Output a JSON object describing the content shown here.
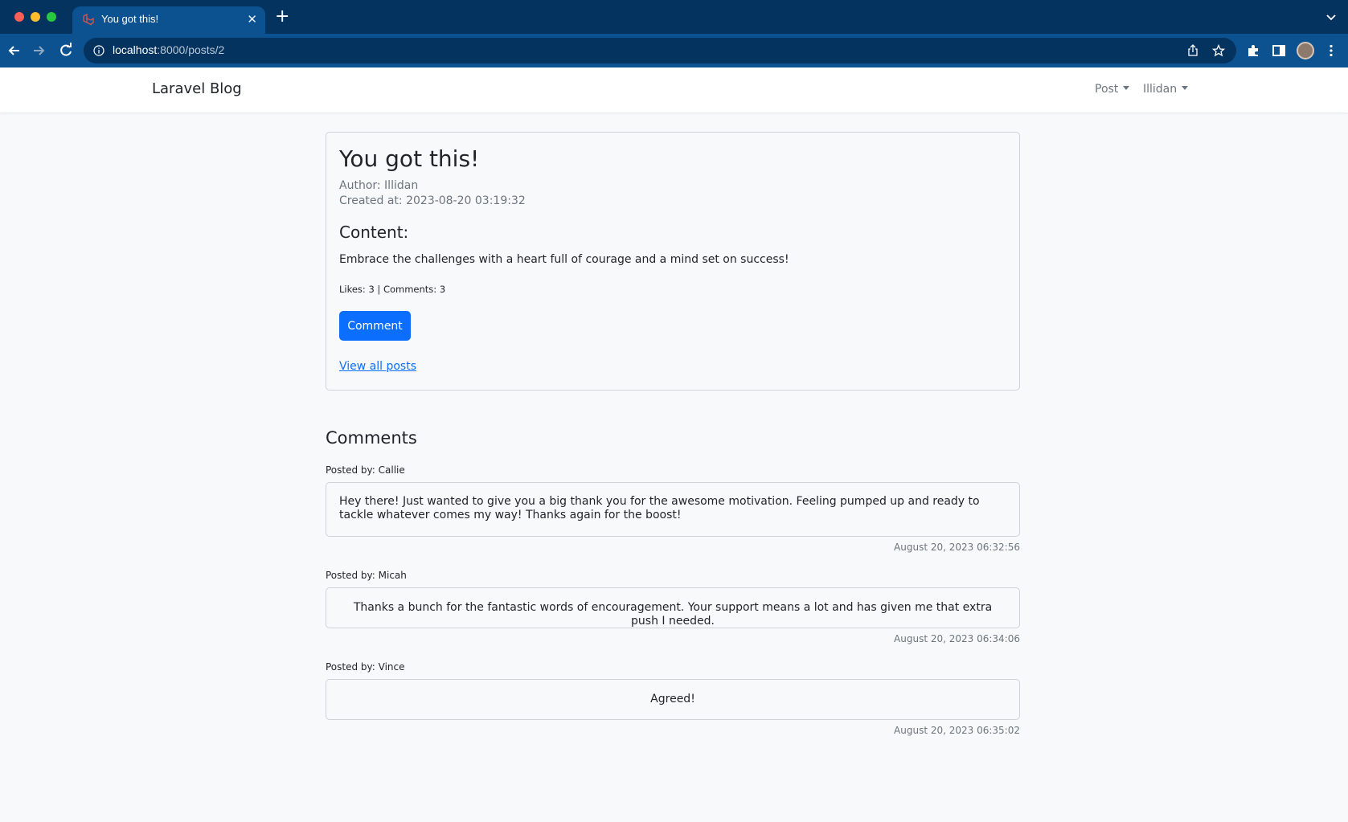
{
  "browser": {
    "tab_title": "You got this!",
    "tab_close": "✕",
    "new_tab": "+",
    "url_host": "localhost",
    "url_path": ":8000/posts/2"
  },
  "navbar": {
    "brand": "Laravel Blog",
    "menus": [
      {
        "label": "Post"
      },
      {
        "label": "Illidan"
      }
    ]
  },
  "post": {
    "title": "You got this!",
    "author": "Author: Illidan",
    "created_at": "Created at: 2023-08-20 03:19:32",
    "content_heading": "Content:",
    "content": "Embrace the challenges with a heart full of courage and a mind set on success!",
    "stats": "Likes: 3 | Comments: 3",
    "comment_button": "Comment",
    "view_all_link": "View all posts"
  },
  "comments": {
    "heading": "Comments",
    "items": [
      {
        "posted_by": "Posted by: Callie",
        "text": "Hey there! Just wanted to give you a big thank you for the awesome motivation. Feeling pumped up and ready to tackle whatever comes my way! Thanks again for the boost!",
        "date": "August 20, 2023 06:32:56"
      },
      {
        "posted_by": "Posted by: Micah",
        "text": "Thanks a bunch for the fantastic words of encouragement. Your support means a lot and has given me that extra push I needed.",
        "date": "August 20, 2023 06:34:06"
      },
      {
        "posted_by": "Posted by: Vince",
        "text": "Agreed!",
        "date": "August 20, 2023 06:35:02"
      }
    ]
  },
  "colors": {
    "chrome_dark": "#04335f",
    "chrome_light": "#0d5290",
    "primary": "#0b6efd",
    "page_bg": "#f8f9fb"
  },
  "icons": [
    "laravel-favicon-icon",
    "back-arrow-icon",
    "forward-arrow-icon",
    "reload-icon",
    "info-icon",
    "share-icon",
    "star-icon",
    "puzzle-icon",
    "side-panel-icon",
    "kebab-menu-icon",
    "chevron-down-icon"
  ]
}
